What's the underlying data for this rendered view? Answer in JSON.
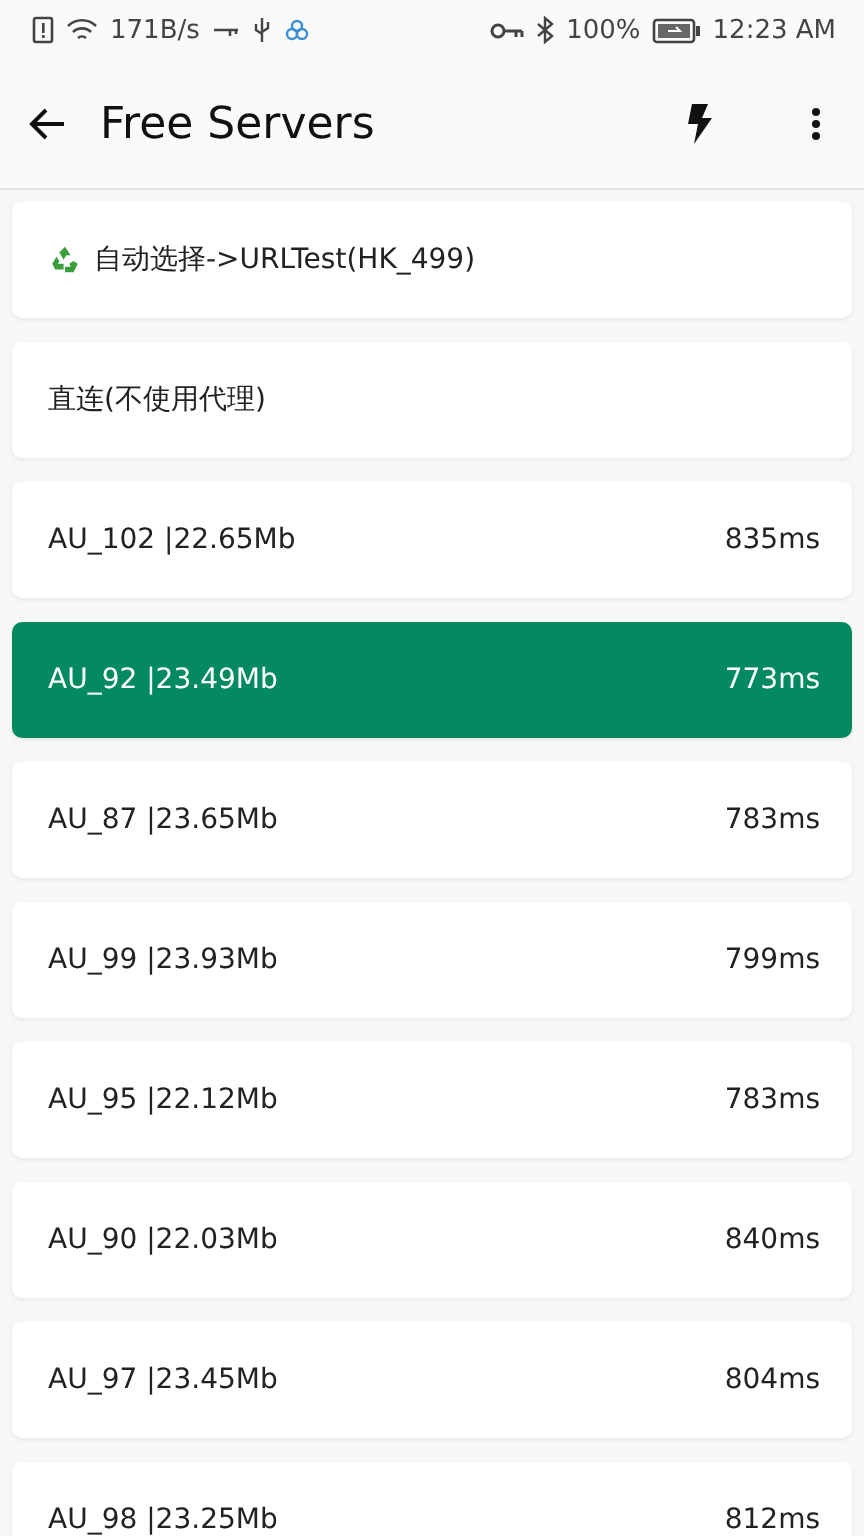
{
  "status_bar": {
    "speed": "171B/s",
    "battery": "100%",
    "time": "12:23 AM"
  },
  "app_bar": {
    "title": "Free Servers"
  },
  "servers": [
    {
      "kind": "auto",
      "name": "自动选择->URLTest(HK_499)",
      "selected": false
    },
    {
      "kind": "direct",
      "name": "直连(不使用代理)",
      "selected": false
    },
    {
      "kind": "server",
      "name": "AU_102 |22.65Mb",
      "latency": "835ms",
      "selected": false
    },
    {
      "kind": "server",
      "name": "AU_92 |23.49Mb",
      "latency": "773ms",
      "selected": true
    },
    {
      "kind": "server",
      "name": "AU_87 |23.65Mb",
      "latency": "783ms",
      "selected": false
    },
    {
      "kind": "server",
      "name": "AU_99 |23.93Mb",
      "latency": "799ms",
      "selected": false
    },
    {
      "kind": "server",
      "name": "AU_95 |22.12Mb",
      "latency": "783ms",
      "selected": false
    },
    {
      "kind": "server",
      "name": "AU_90 |22.03Mb",
      "latency": "840ms",
      "selected": false
    },
    {
      "kind": "server",
      "name": "AU_97 |23.45Mb",
      "latency": "804ms",
      "selected": false
    },
    {
      "kind": "server",
      "name": "AU_98 |23.25Mb",
      "latency": "812ms",
      "selected": false
    }
  ]
}
